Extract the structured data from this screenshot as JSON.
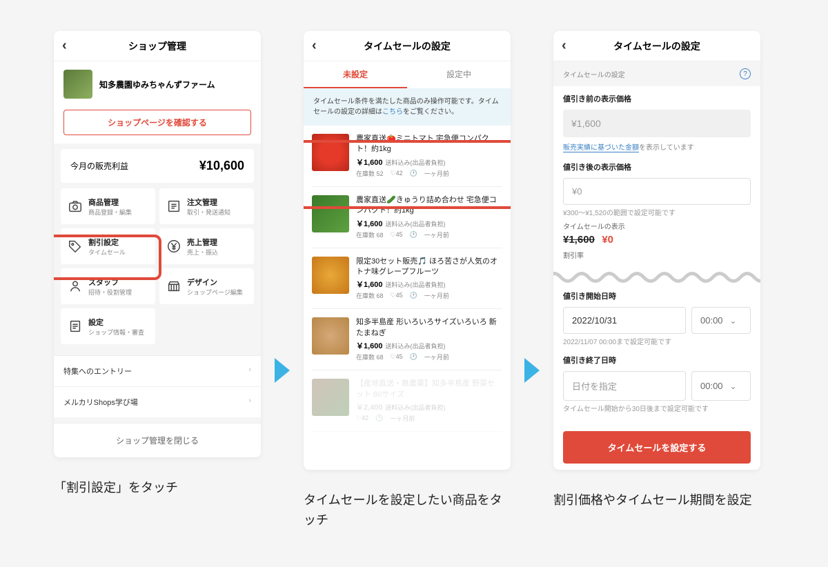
{
  "phone1": {
    "title": "ショップ管理",
    "shop_name": "知多農園ゆみちゃんずファーム",
    "confirm_btn": "ショップページを確認する",
    "profit_label": "今月の販売利益",
    "profit_amount": "¥10,600",
    "cards": {
      "product": {
        "title": "商品管理",
        "sub": "商品登録・編集"
      },
      "order": {
        "title": "注文管理",
        "sub": "取引・発送通知"
      },
      "discount": {
        "title": "割引設定",
        "sub": "タイムセール"
      },
      "sales": {
        "title": "売上管理",
        "sub": "売上・振込"
      },
      "staff": {
        "title": "スタッフ",
        "sub": "招待・役割管理"
      },
      "design": {
        "title": "デザイン",
        "sub": "ショップページ編集"
      },
      "settings": {
        "title": "設定",
        "sub": "ショップ情報・審査"
      }
    },
    "links": {
      "entry": "特集へのエントリー",
      "learn": "メルカリShops学び場"
    },
    "close": "ショップ管理を閉じる"
  },
  "phone2": {
    "title": "タイムセールの設定",
    "tabs": {
      "unset": "未設定",
      "setting": "設定中"
    },
    "notice_pre": "タイムセール条件を満たした商品のみ操作可能です。タイムセールの設定の詳細は",
    "notice_link": "こちら",
    "notice_post": "をご覧ください。",
    "products": [
      {
        "title": "農家直送🍅ミニトマト 宅急便コンパクト！約1kg",
        "price": "￥1,600",
        "ship": "送料込み(出品者負担)",
        "stock": "在庫数 52",
        "like": "♡42",
        "age": "一ヶ月前"
      },
      {
        "title": "農家直送🥒きゅうり詰め合わせ 宅急便コンパクト！約1kg",
        "price": "￥1,600",
        "ship": "送料込み(出品者負担)",
        "stock": "在庫数 68",
        "like": "♡45",
        "age": "一ヶ月前"
      },
      {
        "title": "限定30セット販売🎵 ほろ苦さが人気のオトナ味グレープフルーツ",
        "price": "￥1,600",
        "ship": "送料込み(出品者負担)",
        "stock": "在庫数 68",
        "like": "♡45",
        "age": "一ヶ月前"
      },
      {
        "title": "知多半島産 形いろいろサイズいろいろ 新たまねぎ",
        "price": "￥1,600",
        "ship": "送料込み(出品者負担)",
        "stock": "在庫数 68",
        "like": "♡45",
        "age": "一ヶ月前"
      },
      {
        "title": "【産地直送・無農薬】知多半島産 野菜セット 80サイズ",
        "price": "￥2,400",
        "ship": "送料込み(出品者負担)",
        "stock": "",
        "like": "♡42",
        "age": "一ヶ月前"
      }
    ]
  },
  "phone3": {
    "title": "タイムセールの設定",
    "sec_label": "タイムセールの設定",
    "before_label": "値引き前の表示価格",
    "before_val": "¥1,600",
    "based_on": "販売実績に基づいた金額",
    "based_on_post": "を表示しています",
    "after_label": "値引き後の表示価格",
    "after_val": "¥0",
    "range": "¥300〜¥1,520の範囲で設定可能です",
    "display_label": "タイムセールの表示",
    "strike": "¥1,600",
    "red": "¥0",
    "rate_label": "割引率",
    "start_label": "値引き開始日時",
    "start_date": "2022/10/31",
    "start_time": "00:00",
    "start_hint": "2022/11/07 00:00まで設定可能です",
    "end_label": "値引き終了日時",
    "end_date_ph": "日付を指定",
    "end_time": "00:00",
    "end_hint": "タイムセール開始から30日後まで設定可能です",
    "submit": "タイムセールを設定する"
  },
  "captions": {
    "c1": "「割引設定」をタッチ",
    "c2": "タイムセールを設定したい商品をタッチ",
    "c3": "割引価格やタイムセール期間を設定"
  }
}
